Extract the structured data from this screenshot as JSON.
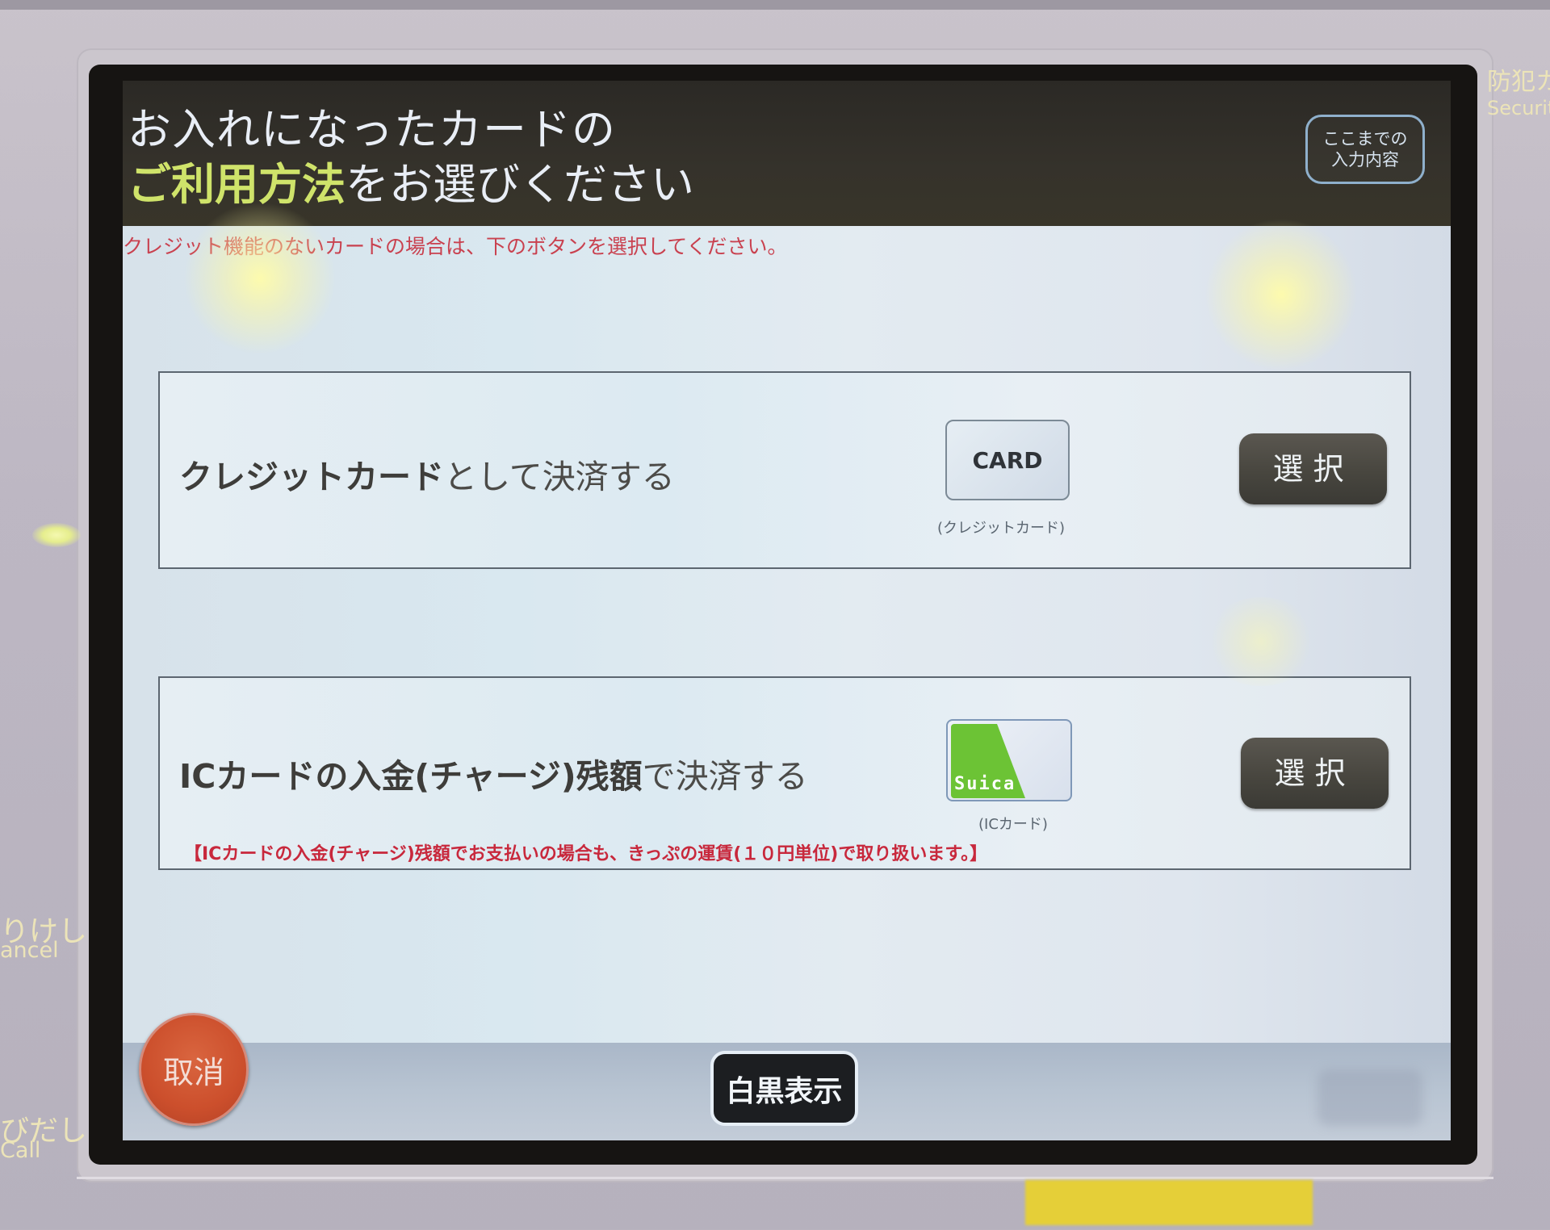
{
  "header": {
    "title_line1": "お入れになったカードの",
    "title_accent": "ご利用方法",
    "title_line2_rest": "をお選びください",
    "history_button_line1": "ここまでの",
    "history_button_line2": "入力内容"
  },
  "notice": "クレジット機能のないカードの場合は、下のボタンを選択してください。",
  "options": [
    {
      "label_bold": "クレジットカード",
      "label_rest": "として決済する",
      "icon": "card-icon",
      "icon_text": "CARD",
      "icon_caption": "(クレジットカード)",
      "select_label": "選択"
    },
    {
      "label_bold": "ICカードの入金(チャージ)残額",
      "label_rest": "で決済する",
      "icon": "suica-card-icon",
      "icon_text": "Suica",
      "icon_caption": "(ICカード)",
      "select_label": "選択",
      "note": "【ICカードの入金(チャージ)残額でお支払いの場合も、きっぷの運賃(１０円単位)で取り扱います。】"
    }
  ],
  "footer": {
    "cancel_label": "取消",
    "monochrome_label": "白黒表示"
  },
  "bezel": {
    "security_jp": "防犯カ",
    "security_en": "Securit",
    "cancel_jp": "りけし",
    "cancel_en": "ancel",
    "call_jp": "びだし",
    "call_en": "Call"
  },
  "colors": {
    "accent_title": "#cfe36a",
    "notice_red": "#c9414f",
    "select_button": "#48463f",
    "cancel_button": "#cc4f2c",
    "suica_green": "#6cc335"
  }
}
